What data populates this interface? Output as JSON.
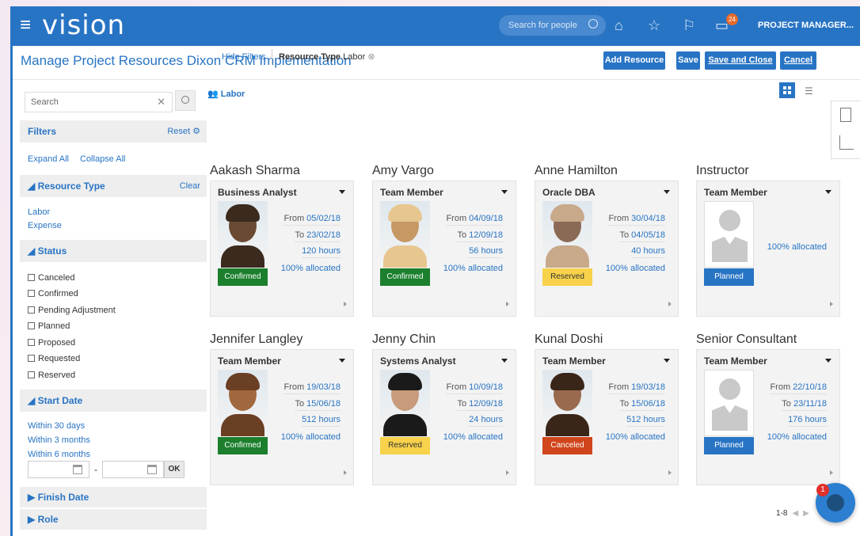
{
  "topbar": {
    "menu_icon": "hamburger-icon",
    "brand": "vision",
    "search_placeholder": "Search for people",
    "notif_count": "24",
    "user": "PROJECT MANAGER..."
  },
  "page": {
    "title": "Manage Project Resources  Dixon CRM Implementation",
    "buttons": {
      "add_resource": "Add Resource",
      "save": "Save",
      "save_close": "Save and Close",
      "cancel": "Cancel"
    }
  },
  "filters": {
    "search_placeholder": "Search",
    "header": "Filters",
    "reset": "Reset",
    "expand_all": "Expand All",
    "collapse_all": "Collapse All",
    "resource_type": {
      "label": "Resource Type",
      "clear": "Clear",
      "options": [
        "Labor",
        "Expense"
      ]
    },
    "status": {
      "label": "Status",
      "options": [
        "Canceled",
        "Confirmed",
        "Pending Adjustment",
        "Planned",
        "Proposed",
        "Requested",
        "Reserved"
      ]
    },
    "start_date": {
      "label": "Start Date",
      "options": [
        "Within 30 days",
        "Within 3 months",
        "Within 6 months"
      ],
      "dash": "-",
      "ok": "OK"
    },
    "finish_date": "Finish Date",
    "role": "Role"
  },
  "content": {
    "hide_filters": "Hide Filters",
    "chip_label": "Resource Type",
    "chip_value": "Labor",
    "section": "Labor"
  },
  "cards": [
    {
      "name": "Aakash Sharma",
      "role": "Business Analyst",
      "from": "05/02/18",
      "to": "23/02/18",
      "hours": "120 hours",
      "alloc": "100% allocated",
      "status": "Confirmed"
    },
    {
      "name": "Amy Vargo",
      "role": "Team Member",
      "from": "04/09/18",
      "to": "12/09/18",
      "hours": "56 hours",
      "alloc": "100% allocated",
      "status": "Confirmed"
    },
    {
      "name": "Anne Hamilton",
      "role": "Oracle DBA",
      "from": "30/04/18",
      "to": "04/05/18",
      "hours": "40 hours",
      "alloc": "100% allocated",
      "status": "Reserved"
    },
    {
      "name": "Instructor",
      "role": "Team Member",
      "alloc": "100% allocated",
      "status": "Planned"
    },
    {
      "name": "Jennifer Langley",
      "role": "Team Member",
      "from": "19/03/18",
      "to": "15/06/18",
      "hours": "512 hours",
      "alloc": "100% allocated",
      "status": "Confirmed"
    },
    {
      "name": "Jenny Chin",
      "role": "Systems Analyst",
      "from": "10/09/18",
      "to": "12/09/18",
      "hours": "24 hours",
      "alloc": "100% allocated",
      "status": "Reserved"
    },
    {
      "name": "Kunal Doshi",
      "role": "Team Member",
      "from": "19/03/18",
      "to": "15/06/18",
      "hours": "512 hours",
      "alloc": "100% allocated",
      "status": "Canceled"
    },
    {
      "name": "Senior Consultant",
      "role": "Team Member",
      "from": "22/10/18",
      "to": "23/11/18",
      "hours": "176 hours",
      "alloc": "100% allocated",
      "status": "Planned"
    }
  ],
  "labels": {
    "from": "From",
    "to": "To"
  },
  "pager": "1-8",
  "chat_badge": "1",
  "colors": {
    "accent": "#2874c4",
    "confirmed": "#1b7f2d",
    "reserved": "#f7d24a",
    "planned": "#2874c4",
    "canceled": "#d0451b"
  }
}
